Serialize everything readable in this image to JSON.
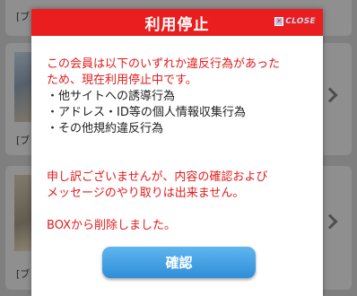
{
  "background": {
    "cards": [
      {
        "label": "[ブ"
      },
      {
        "label": "[ブ"
      },
      {
        "label": "[ブ"
      }
    ]
  },
  "dialog": {
    "title": "利用停止",
    "close_label": "CLOSE",
    "intro_line1": "この会員は以下のいずれか違反行為があった",
    "intro_line2": "ため、現在利用停止中です。",
    "violations": [
      "・他サイトへの誘導行為",
      "・アドレス・ID等の個人情報収集行為",
      "・その他規約違反行為"
    ],
    "apology_line1": "申し訳ございませんが、内容の確認および",
    "apology_line2": "メッセージのやり取りは出来ません。",
    "removed_notice": "BOXから削除しました。",
    "confirm_label": "確認"
  },
  "colors": {
    "header": "#ea1e1e",
    "warning_text": "#e21b1b",
    "button": "#2f8ed9"
  }
}
